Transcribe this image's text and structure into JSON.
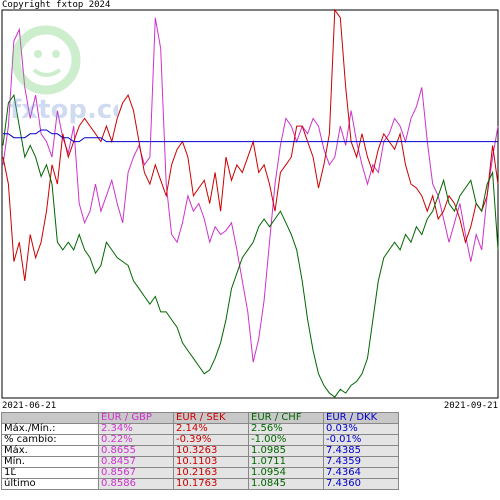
{
  "copyright": "Copyright fxtop 2024",
  "watermark": "fxtop.com",
  "dates": {
    "start": "2021-06-21",
    "end": "2021-09-21"
  },
  "colors": {
    "EUR/GBP": "#cc33cc",
    "EUR/SEK": "#cc0000",
    "EUR/CHF": "#006600",
    "EUR/DKK": "#0000cc"
  },
  "table": {
    "headers": [
      "",
      "EUR / GBP",
      "EUR / SEK",
      "EUR / CHF",
      "EUR / DKK"
    ],
    "rows": [
      [
        "Máx./Mín.:",
        "2.34%",
        "2.14%",
        "2.56%",
        "0.03%"
      ],
      [
        "% cambio:",
        "0.22%",
        "-0.39%",
        "-1.00%",
        "-0.01%"
      ],
      [
        "Máx.",
        "0.8655",
        "10.3263",
        "1.0985",
        "7.4385"
      ],
      [
        "Mín.",
        "0.8457",
        "10.1103",
        "1.0711",
        "7.4359"
      ],
      [
        "1Ľ",
        "0.8567",
        "10.2163",
        "1.0954",
        "7.4364"
      ],
      [
        "último",
        "0.8586",
        "10.1763",
        "1.0845",
        "7.4360"
      ]
    ]
  },
  "chart_data": {
    "type": "line",
    "x_range": [
      "2021-06-21",
      "2021-09-21"
    ],
    "ylim": [
      0,
      1
    ],
    "grid": false,
    "series": [
      {
        "name": "EUR / GBP",
        "color": "#cc33cc",
        "values": [
          0.6,
          0.7,
          0.92,
          0.95,
          0.8,
          0.72,
          0.78,
          0.68,
          0.66,
          0.62,
          0.74,
          0.67,
          0.63,
          0.7,
          0.5,
          0.45,
          0.48,
          0.55,
          0.48,
          0.52,
          0.56,
          0.5,
          0.45,
          0.58,
          0.62,
          0.65,
          0.6,
          0.62,
          0.98,
          0.9,
          0.55,
          0.42,
          0.4,
          0.45,
          0.52,
          0.48,
          0.5,
          0.46,
          0.4,
          0.44,
          0.42,
          0.43,
          0.45,
          0.38,
          0.3,
          0.22,
          0.09,
          0.15,
          0.25,
          0.4,
          0.55,
          0.65,
          0.72,
          0.7,
          0.66,
          0.7,
          0.68,
          0.72,
          0.7,
          0.64,
          0.6,
          0.62,
          0.7,
          0.65,
          0.74,
          0.66,
          0.6,
          0.55,
          0.6,
          0.58,
          0.66,
          0.68,
          0.72,
          0.7,
          0.66,
          0.72,
          0.75,
          0.8,
          0.66,
          0.55,
          0.52,
          0.46,
          0.4,
          0.45,
          0.5,
          0.42,
          0.35,
          0.42,
          0.38,
          0.52,
          0.62,
          0.7
        ]
      },
      {
        "name": "EUR / SEK",
        "color": "#cc0000",
        "values": [
          0.62,
          0.55,
          0.35,
          0.4,
          0.3,
          0.42,
          0.36,
          0.4,
          0.48,
          0.6,
          0.55,
          0.68,
          0.62,
          0.66,
          0.7,
          0.72,
          0.7,
          0.68,
          0.66,
          0.7,
          0.66,
          0.72,
          0.76,
          0.78,
          0.74,
          0.66,
          0.58,
          0.55,
          0.6,
          0.56,
          0.52,
          0.6,
          0.64,
          0.66,
          0.62,
          0.52,
          0.54,
          0.56,
          0.5,
          0.58,
          0.48,
          0.62,
          0.56,
          0.6,
          0.58,
          0.62,
          0.66,
          0.58,
          0.6,
          0.55,
          0.48,
          0.58,
          0.6,
          0.62,
          0.7,
          0.7,
          0.66,
          0.62,
          0.54,
          0.6,
          0.68,
          1.0,
          0.98,
          0.8,
          0.66,
          0.62,
          0.68,
          0.62,
          0.58,
          0.64,
          0.68,
          0.66,
          0.64,
          0.68,
          0.6,
          0.55,
          0.54,
          0.52,
          0.48,
          0.52,
          0.46,
          0.48,
          0.52,
          0.5,
          0.46,
          0.4,
          0.44,
          0.5,
          0.48,
          0.52,
          0.65,
          0.55
        ]
      },
      {
        "name": "EUR / CHF",
        "color": "#006600",
        "values": [
          0.65,
          0.76,
          0.78,
          0.7,
          0.62,
          0.65,
          0.62,
          0.57,
          0.6,
          0.55,
          0.4,
          0.38,
          0.4,
          0.38,
          0.42,
          0.38,
          0.36,
          0.32,
          0.34,
          0.4,
          0.38,
          0.36,
          0.35,
          0.34,
          0.3,
          0.28,
          0.26,
          0.24,
          0.26,
          0.22,
          0.22,
          0.2,
          0.18,
          0.14,
          0.12,
          0.1,
          0.08,
          0.06,
          0.07,
          0.1,
          0.14,
          0.2,
          0.28,
          0.32,
          0.36,
          0.38,
          0.4,
          0.44,
          0.46,
          0.44,
          0.46,
          0.48,
          0.45,
          0.42,
          0.38,
          0.3,
          0.2,
          0.12,
          0.06,
          0.03,
          0.01,
          0.0,
          0.02,
          0.01,
          0.03,
          0.04,
          0.06,
          0.1,
          0.2,
          0.3,
          0.36,
          0.38,
          0.4,
          0.38,
          0.42,
          0.4,
          0.44,
          0.42,
          0.46,
          0.48,
          0.52,
          0.56,
          0.5,
          0.48,
          0.52,
          0.54,
          0.56,
          0.5,
          0.48,
          0.55,
          0.58,
          0.38
        ]
      },
      {
        "name": "EUR / DKK",
        "color": "#0000cc",
        "values": [
          0.68,
          0.68,
          0.67,
          0.67,
          0.67,
          0.68,
          0.68,
          0.69,
          0.69,
          0.68,
          0.68,
          0.67,
          0.67,
          0.66,
          0.66,
          0.67,
          0.67,
          0.67,
          0.67,
          0.66,
          0.66,
          0.66,
          0.66,
          0.66,
          0.66,
          0.66,
          0.66,
          0.66,
          0.66,
          0.66,
          0.66,
          0.66,
          0.66,
          0.66,
          0.66,
          0.66,
          0.66,
          0.66,
          0.66,
          0.66,
          0.66,
          0.66,
          0.66,
          0.66,
          0.66,
          0.66,
          0.66,
          0.66,
          0.66,
          0.66,
          0.66,
          0.66,
          0.66,
          0.66,
          0.66,
          0.66,
          0.66,
          0.66,
          0.66,
          0.66,
          0.66,
          0.66,
          0.66,
          0.66,
          0.66,
          0.66,
          0.66,
          0.66,
          0.66,
          0.66,
          0.66,
          0.66,
          0.66,
          0.66,
          0.66,
          0.66,
          0.66,
          0.66,
          0.66,
          0.66,
          0.66,
          0.66,
          0.66,
          0.66,
          0.66,
          0.66,
          0.66,
          0.66,
          0.66,
          0.66,
          0.66,
          0.66
        ]
      }
    ]
  }
}
